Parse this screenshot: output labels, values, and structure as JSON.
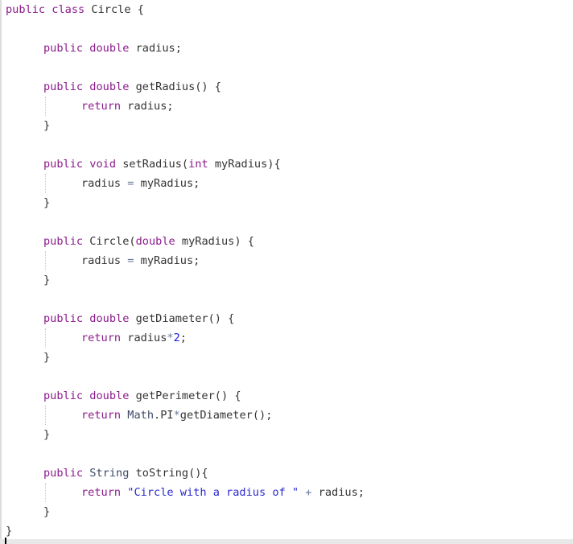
{
  "colors": {
    "keyword": "#8c1b8c",
    "string": "#2a2ad0",
    "number": "#1a1ae0",
    "operator": "#6a7a9a",
    "type": "#3f4a66",
    "plain": "#333333"
  },
  "lines": [
    {
      "indent": 0,
      "tokens": [
        [
          "kw",
          "public"
        ],
        [
          "plain",
          " "
        ],
        [
          "kw",
          "class"
        ],
        [
          "plain",
          " Circle {"
        ]
      ]
    },
    {
      "indent": 0,
      "tokens": []
    },
    {
      "indent": 1,
      "tokens": [
        [
          "kw",
          "public"
        ],
        [
          "plain",
          " "
        ],
        [
          "kw",
          "double"
        ],
        [
          "plain",
          " radius;"
        ]
      ]
    },
    {
      "indent": 0,
      "tokens": []
    },
    {
      "indent": 1,
      "tokens": [
        [
          "kw",
          "public"
        ],
        [
          "plain",
          " "
        ],
        [
          "kw",
          "double"
        ],
        [
          "plain",
          " getRadius() {"
        ]
      ]
    },
    {
      "indent": 2,
      "guide": true,
      "tokens": [
        [
          "kw",
          "return"
        ],
        [
          "plain",
          " radius;"
        ]
      ]
    },
    {
      "indent": 1,
      "tokens": [
        [
          "plain",
          "}"
        ]
      ]
    },
    {
      "indent": 0,
      "tokens": []
    },
    {
      "indent": 1,
      "tokens": [
        [
          "kw",
          "public"
        ],
        [
          "plain",
          " "
        ],
        [
          "kw",
          "void"
        ],
        [
          "plain",
          " setRadius("
        ],
        [
          "kw",
          "int"
        ],
        [
          "plain",
          " myRadius){"
        ]
      ]
    },
    {
      "indent": 2,
      "guide": true,
      "tokens": [
        [
          "plain",
          "radius "
        ],
        [
          "op",
          "="
        ],
        [
          "plain",
          " myRadius;"
        ]
      ]
    },
    {
      "indent": 1,
      "tokens": [
        [
          "plain",
          "}"
        ]
      ]
    },
    {
      "indent": 0,
      "tokens": []
    },
    {
      "indent": 1,
      "tokens": [
        [
          "kw",
          "public"
        ],
        [
          "plain",
          " Circle("
        ],
        [
          "kw",
          "double"
        ],
        [
          "plain",
          " myRadius) {"
        ]
      ]
    },
    {
      "indent": 2,
      "guide": true,
      "tokens": [
        [
          "plain",
          "radius "
        ],
        [
          "op",
          "="
        ],
        [
          "plain",
          " myRadius;"
        ]
      ]
    },
    {
      "indent": 1,
      "tokens": [
        [
          "plain",
          "}"
        ]
      ]
    },
    {
      "indent": 0,
      "tokens": []
    },
    {
      "indent": 1,
      "tokens": [
        [
          "kw",
          "public"
        ],
        [
          "plain",
          " "
        ],
        [
          "kw",
          "double"
        ],
        [
          "plain",
          " getDiameter() {"
        ]
      ]
    },
    {
      "indent": 2,
      "guide": true,
      "tokens": [
        [
          "kw",
          "return"
        ],
        [
          "plain",
          " radius"
        ],
        [
          "op",
          "*"
        ],
        [
          "num",
          "2"
        ],
        [
          "plain",
          ";"
        ]
      ]
    },
    {
      "indent": 1,
      "tokens": [
        [
          "plain",
          "}"
        ]
      ]
    },
    {
      "indent": 0,
      "tokens": []
    },
    {
      "indent": 1,
      "tokens": [
        [
          "kw",
          "public"
        ],
        [
          "plain",
          " "
        ],
        [
          "kw",
          "double"
        ],
        [
          "plain",
          " getPerimeter() {"
        ]
      ]
    },
    {
      "indent": 2,
      "guide": true,
      "tokens": [
        [
          "kw",
          "return"
        ],
        [
          "plain",
          " "
        ],
        [
          "type",
          "Math"
        ],
        [
          "plain",
          ".PI"
        ],
        [
          "op",
          "*"
        ],
        [
          "plain",
          "getDiameter();"
        ]
      ]
    },
    {
      "indent": 1,
      "tokens": [
        [
          "plain",
          "}"
        ]
      ]
    },
    {
      "indent": 0,
      "tokens": []
    },
    {
      "indent": 1,
      "tokens": [
        [
          "kw",
          "public"
        ],
        [
          "plain",
          " "
        ],
        [
          "type",
          "String"
        ],
        [
          "plain",
          " toString(){"
        ]
      ]
    },
    {
      "indent": 2,
      "guide": true,
      "tokens": [
        [
          "kw",
          "return"
        ],
        [
          "plain",
          " "
        ],
        [
          "str",
          "\"Circle with a radius of \""
        ],
        [
          "plain",
          " "
        ],
        [
          "op",
          "+"
        ],
        [
          "plain",
          " radius;"
        ]
      ]
    },
    {
      "indent": 1,
      "tokens": [
        [
          "plain",
          "}"
        ]
      ]
    },
    {
      "indent": 0,
      "tokens": [
        [
          "plain",
          "}"
        ]
      ]
    }
  ]
}
